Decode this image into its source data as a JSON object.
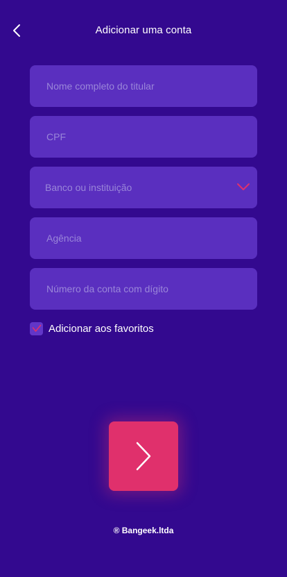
{
  "header": {
    "title": "Adicionar uma conta",
    "back_icon": "chevron-left-icon"
  },
  "form": {
    "full_name": {
      "placeholder": "Nome completo do titular",
      "value": ""
    },
    "cpf": {
      "placeholder": "CPF",
      "value": ""
    },
    "bank": {
      "label": "Banco ou instituição",
      "icon": "chevron-down-icon"
    },
    "agency": {
      "placeholder": "Agência",
      "value": ""
    },
    "account": {
      "placeholder": "Número da conta com dígito",
      "value": ""
    },
    "favorites": {
      "label": "Adicionar aos favoritos",
      "checked": true
    }
  },
  "next_button": {
    "icon": "chevron-right-icon"
  },
  "footer": {
    "text": "® Bangeek.ltda"
  },
  "colors": {
    "background": "#33098F",
    "field_bg": "#5A2FBF",
    "placeholder": "#9A86D9",
    "accent": "#E0306C"
  }
}
